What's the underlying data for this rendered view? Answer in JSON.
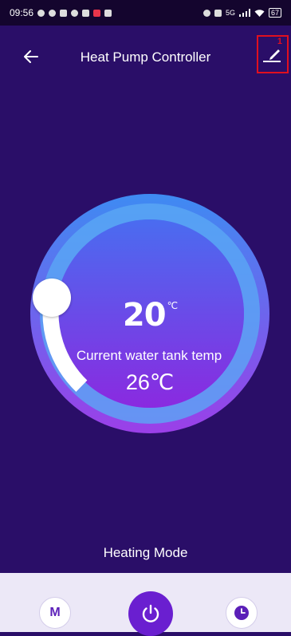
{
  "status_bar": {
    "time": "09:56",
    "signal": "5G",
    "battery": "67"
  },
  "header": {
    "back_icon": "arrow-left-icon",
    "title": "Heat Pump Controller",
    "edit_icon": "edit-pencil-icon",
    "edit_marker": "1"
  },
  "dial": {
    "set_temperature": "20",
    "set_unit": "℃",
    "tank_label": "Current water tank temp",
    "tank_temperature": "26℃",
    "colors": {
      "track_top": "#3e8bf2",
      "track_bottom": "#9b3fe8",
      "inner_top": "#4a6cf0",
      "inner_bottom": "#8a2ae0"
    }
  },
  "mode": {
    "label": "Heating Mode"
  },
  "bottom_bar": {
    "mode_button_label": "M",
    "power_icon": "power-icon",
    "timer_icon": "clock-icon",
    "accent": "#6a1fd0"
  }
}
